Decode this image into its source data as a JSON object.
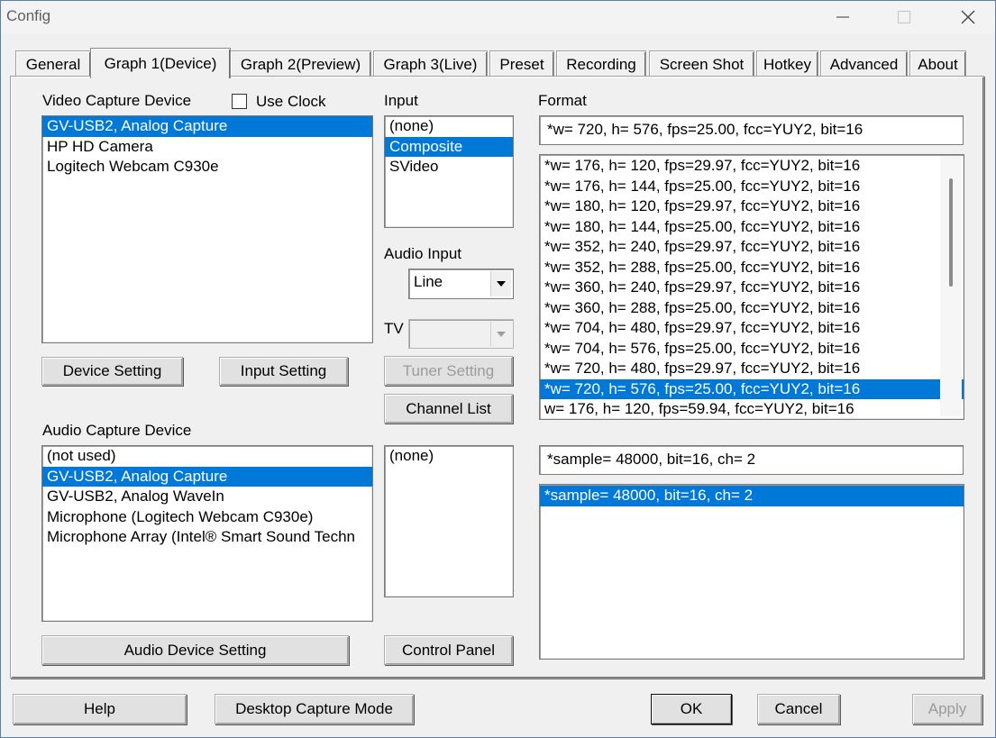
{
  "window": {
    "title": "Config"
  },
  "tabs": [
    "General",
    "Graph 1(Device)",
    "Graph 2(Preview)",
    "Graph 3(Live)",
    "Preset",
    "Recording",
    "Screen Shot",
    "Hotkey",
    "Advanced",
    "About"
  ],
  "video": {
    "label": "Video Capture Device",
    "use_clock_label": "Use Clock",
    "devices": [
      "GV-USB2, Analog Capture",
      "HP HD Camera",
      "Logitech Webcam C930e"
    ],
    "selected_index": 0,
    "device_setting": "Device Setting",
    "input_setting": "Input Setting"
  },
  "input": {
    "label": "Input",
    "items": [
      "(none)",
      "Composite",
      "SVideo"
    ],
    "selected_index": 1,
    "audio_input_label": "Audio Input",
    "audio_input_value": "Line",
    "tv_label": "TV",
    "tuner_setting": "Tuner Setting",
    "channel_list": "Channel List",
    "control_panel": "Control Panel"
  },
  "format": {
    "label": "Format",
    "current": "*w= 720, h= 576, fps=25.00,  fcc=YUY2, bit=16",
    "items": [
      "*w= 176, h= 120, fps=29.97,  fcc=YUY2, bit=16",
      "*w= 176, h= 144, fps=25.00,  fcc=YUY2, bit=16",
      "*w= 180, h= 120, fps=29.97,  fcc=YUY2, bit=16",
      "*w= 180, h= 144, fps=25.00,  fcc=YUY2, bit=16",
      "*w= 352, h= 240, fps=29.97,  fcc=YUY2, bit=16",
      "*w= 352, h= 288, fps=25.00,  fcc=YUY2, bit=16",
      "*w= 360, h= 240, fps=29.97,  fcc=YUY2, bit=16",
      "*w= 360, h= 288, fps=25.00,  fcc=YUY2, bit=16",
      "*w= 704, h= 480, fps=29.97,  fcc=YUY2, bit=16",
      "*w= 704, h= 576, fps=25.00,  fcc=YUY2, bit=16",
      "*w= 720, h= 480, fps=29.97,  fcc=YUY2, bit=16",
      "*w= 720, h= 576, fps=25.00,  fcc=YUY2, bit=16",
      "w= 176, h= 120, fps=59.94,  fcc=YUY2, bit=16"
    ],
    "selected_index": 11
  },
  "audio": {
    "label": "Audio Capture Device",
    "devices": [
      "(not used)",
      "GV-USB2, Analog Capture",
      "GV-USB2, Analog WaveIn",
      "Microphone (Logitech Webcam C930e)",
      "Microphone Array (Intel® Smart Sound Techn"
    ],
    "selected_index": 1,
    "device_setting": "Audio Device Setting",
    "input_items": [
      "(none)"
    ],
    "format_current": "*sample= 48000, bit=16, ch= 2",
    "format_items": [
      "*sample= 48000, bit=16, ch= 2"
    ],
    "format_selected_index": 0
  },
  "footer": {
    "help": "Help",
    "desktop_capture": "Desktop Capture Mode",
    "ok": "OK",
    "cancel": "Cancel",
    "apply": "Apply"
  },
  "colors": {
    "selection": "#0078d7",
    "face": "#f0f0f0",
    "window_border": "#5a7fb6"
  }
}
